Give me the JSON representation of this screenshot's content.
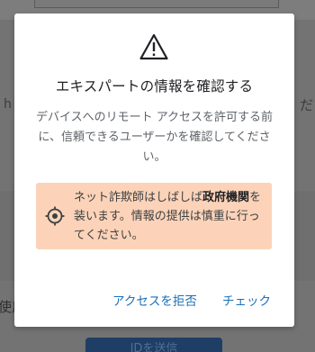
{
  "background": {
    "fragment_left": "h",
    "fragment_right": "だ",
    "fragment_bottom_left": "使用",
    "button_label": "IDを送信"
  },
  "dialog": {
    "icon": "warning-icon",
    "title": "エキスパートの情報を確認する",
    "body": "デバイスへのリモート アクセスを許可する前に、信頼できるユーザーかを確認してください。",
    "warning": {
      "icon": "target-icon",
      "text_part1": "ネット詐欺師はしばしば",
      "text_bold": "政府機関",
      "text_part2": "を装います。情報の提供は慎重に行ってください。",
      "background_color": "#fcd3b8"
    },
    "buttons": {
      "deny_label": "アクセスを拒否",
      "check_label": "チェック"
    },
    "accent_color": "#1c6fb8"
  }
}
